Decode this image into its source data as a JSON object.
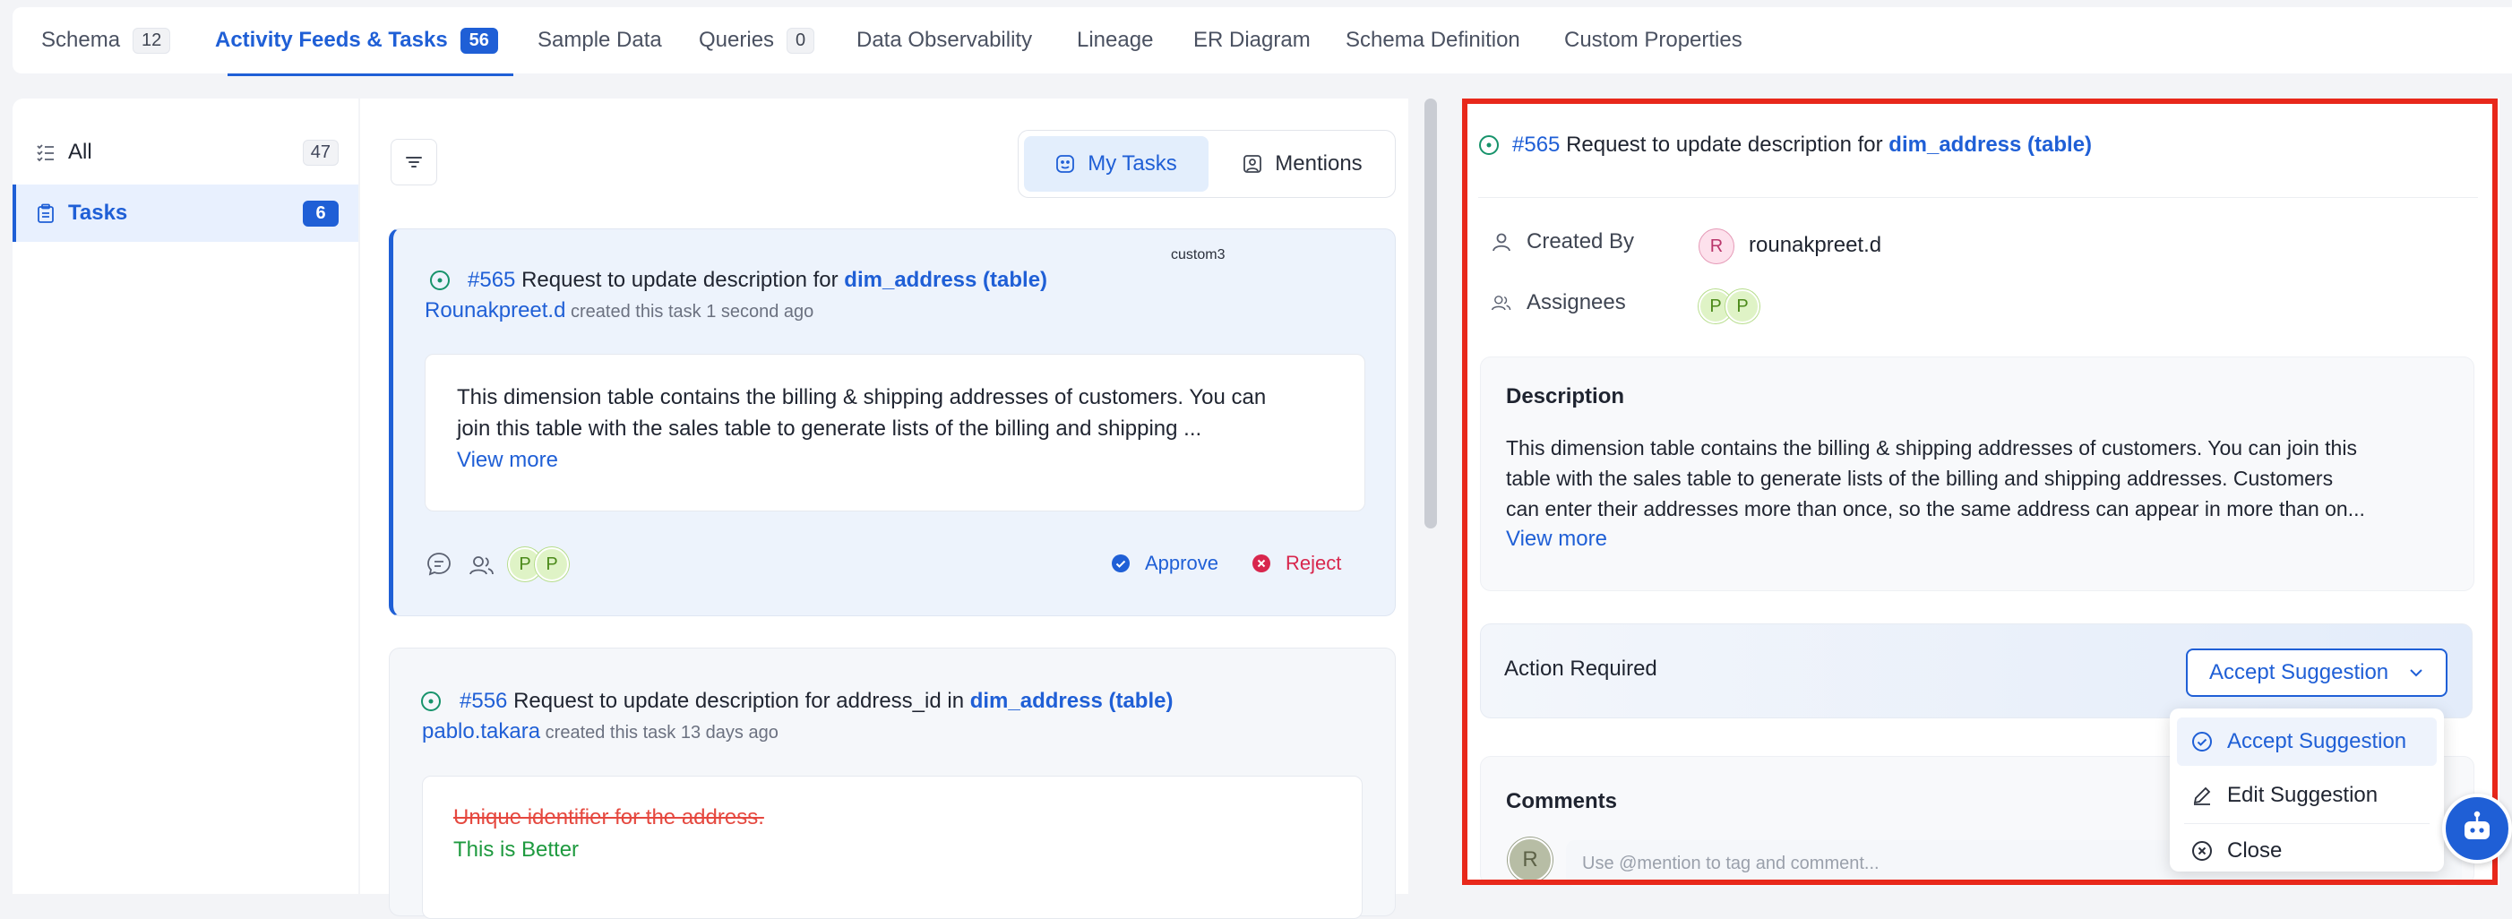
{
  "tabs": [
    {
      "label": "Schema",
      "count": "12"
    },
    {
      "label": "Activity Feeds & Tasks",
      "count": "56"
    },
    {
      "label": "Sample Data"
    },
    {
      "label": "Queries",
      "count": "0"
    },
    {
      "label": "Data Observability"
    },
    {
      "label": "Lineage"
    },
    {
      "label": "ER Diagram"
    },
    {
      "label": "Schema Definition"
    },
    {
      "label": "Custom Properties"
    }
  ],
  "sidebar": {
    "items": [
      {
        "label": "All",
        "count": "47"
      },
      {
        "label": "Tasks",
        "count": "6"
      }
    ]
  },
  "feed": {
    "toggle": {
      "my_tasks": "My Tasks",
      "mentions": "Mentions"
    },
    "tasks": [
      {
        "number": "#565",
        "title_prefix": "Request to update description for",
        "entity": "dim_address (table)",
        "tag": "custom3",
        "user": "Rounakpreet.d",
        "meta": "created this task 1 second ago",
        "description_line1": "This dimension table contains the billing & shipping addresses of customers. You can",
        "description_line2": "join this table with the sales table to generate lists of the billing and shipping ...",
        "view_more": "View more",
        "assignee_initials": [
          "P",
          "P"
        ],
        "approve": "Approve",
        "reject": "Reject"
      },
      {
        "number": "#556",
        "title_prefix": "Request to update description for address_id in",
        "entity": "dim_address (table)",
        "user": "pablo.takara",
        "meta": "created this task 13 days ago",
        "old_text": "Unique identifier for the address.",
        "new_text": "This is Better"
      }
    ]
  },
  "detail": {
    "number": "#565",
    "title_prefix": "Request to update description for",
    "entity": "dim_address (table)",
    "created_by_label": "Created By",
    "creator_initial": "R",
    "creator": "rounakpreet.d",
    "assignees_label": "Assignees",
    "assignee_initials": [
      "P",
      "P"
    ],
    "description_title": "Description",
    "description_lines": [
      "This dimension table contains the billing & shipping addresses of customers. You can join this",
      "table with the sales table to generate lists of the billing and shipping addresses. Customers",
      "can enter their addresses more than once, so the same address can appear in more than on..."
    ],
    "view_more": "View more",
    "action_required": "Action Required",
    "accept_button": "Accept Suggestion",
    "dropdown": [
      "Accept Suggestion",
      "Edit Suggestion",
      "Close"
    ],
    "comments_title": "Comments",
    "commenter_initial": "R",
    "comment_placeholder": "Use @mention to tag and comment..."
  },
  "colors": {
    "accent": "#1f5fd6",
    "highlight_frame": "#e8281b",
    "approve": "#1f5fd6",
    "reject": "#d8264d",
    "open_status": "#17936b",
    "removed_text": "#e5483f",
    "added_text": "#1e9a3f"
  }
}
